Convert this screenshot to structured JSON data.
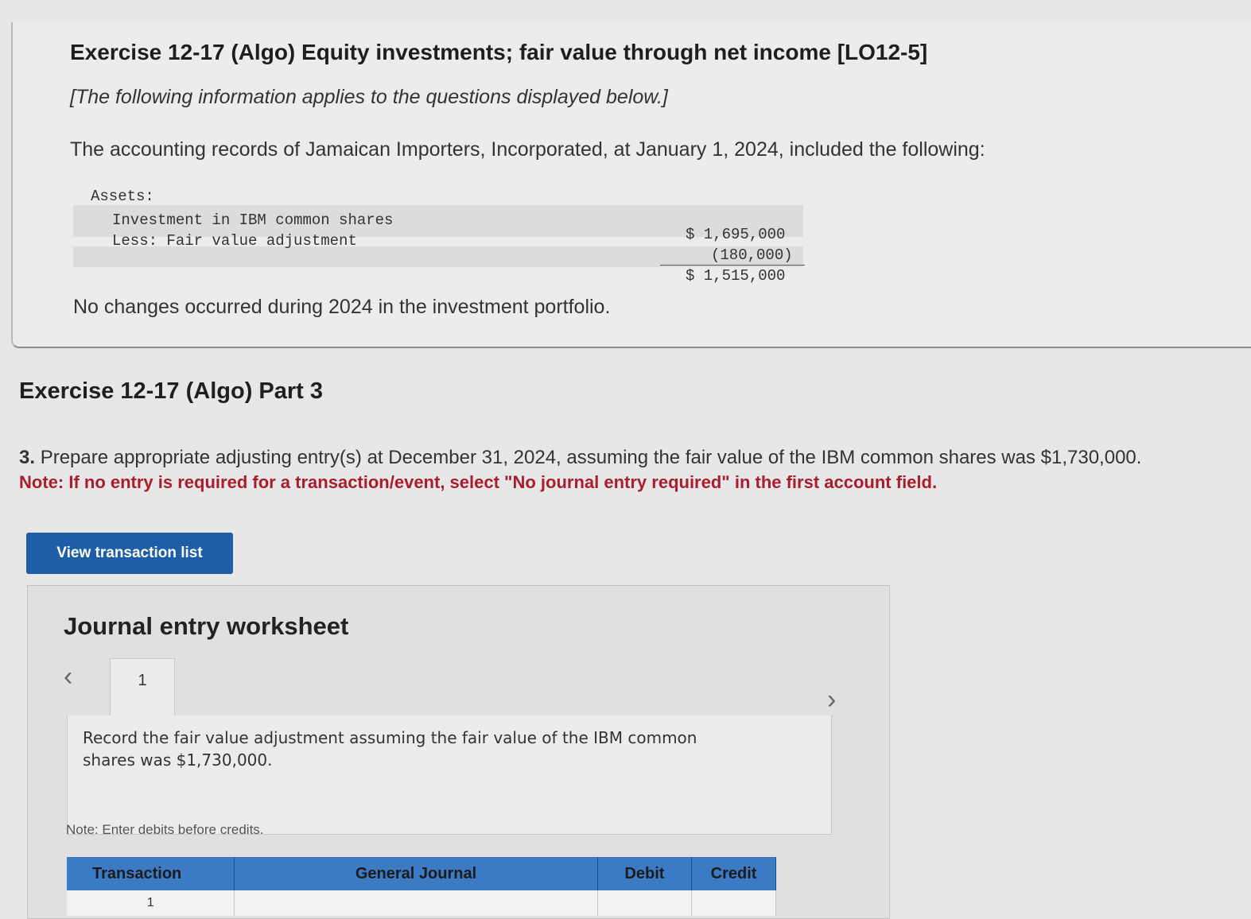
{
  "exercise": {
    "title": "Exercise 12-17 (Algo) Equity investments; fair value through net income [LO12-5]",
    "subtitle": "[The following information applies to the questions displayed below.]",
    "intro": "The accounting records of Jamaican Importers, Incorporated, at January 1, 2024, included the following:",
    "assets_label": "Assets:",
    "items": [
      {
        "label": "Investment in IBM common shares",
        "value": "$ 1,695,000"
      },
      {
        "label": "Less: Fair value adjustment",
        "value": "(180,000)"
      }
    ],
    "total": "$ 1,515,000",
    "no_change_note": "No changes occurred during 2024 in the investment portfolio."
  },
  "part": {
    "title": "Exercise 12-17 (Algo) Part 3",
    "question_number": "3.",
    "question": "Prepare appropriate adjusting entry(s) at December 31, 2024, assuming the fair value of the IBM common shares was $1,730,000.",
    "note": "Note: If no entry is required for a transaction/event, select \"No journal entry required\" in the first account field."
  },
  "buttons": {
    "view_transactions": "View transaction list"
  },
  "worksheet": {
    "title": "Journal entry worksheet",
    "prev_icon": "chevron-left-icon",
    "next_icon": "chevron-right-icon",
    "tab_label": "1",
    "instruction": "Record the fair value adjustment assuming the fair value of the IBM common shares was $1,730,000.",
    "enter_note": "Note: Enter debits before credits.",
    "table": {
      "headers": [
        "Transaction",
        "General Journal",
        "Debit",
        "Credit"
      ],
      "first_row_transaction": "1"
    }
  }
}
